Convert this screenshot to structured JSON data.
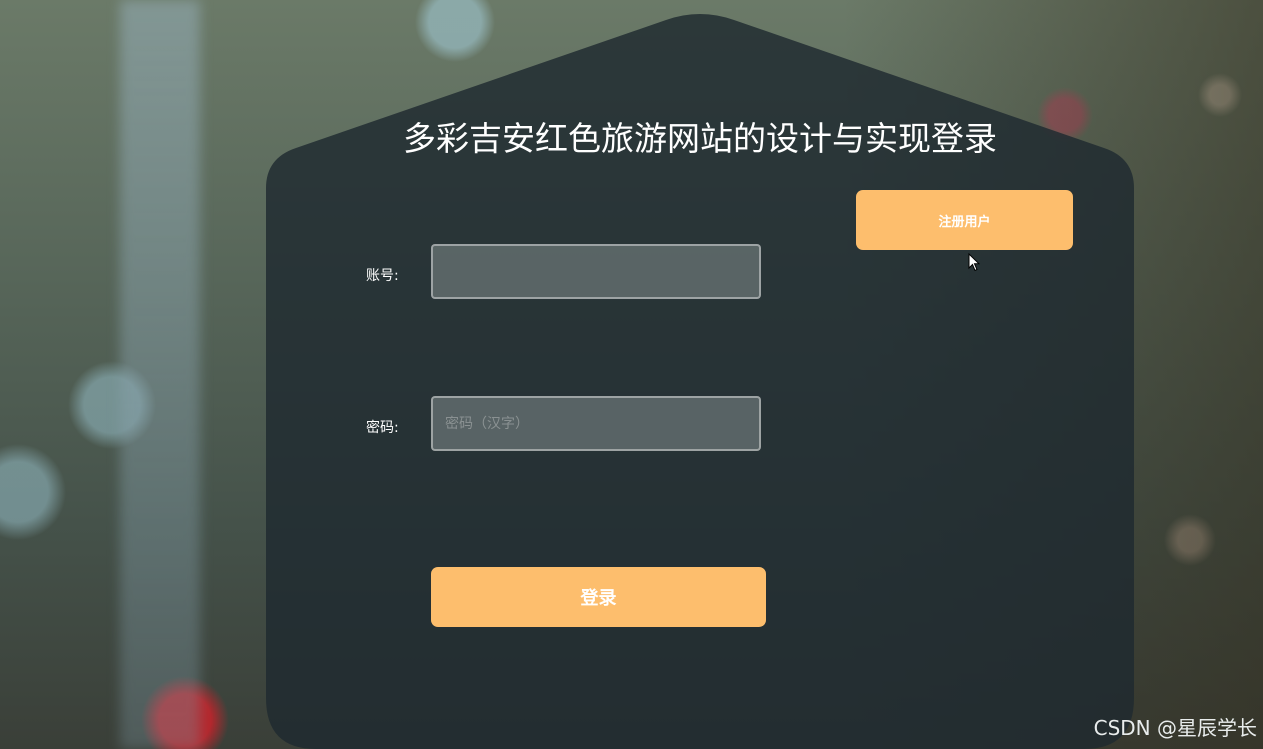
{
  "page": {
    "title": "多彩吉安红色旅游网站的设计与实现登录"
  },
  "form": {
    "account_label": "账号:",
    "account_value": "",
    "account_placeholder": "",
    "password_label": "密码:",
    "password_value": "",
    "password_placeholder": "密码（汉字）",
    "login_label": "登录"
  },
  "register_button_label": "注册用户",
  "watermark": "CSDN @星辰学长",
  "colors": {
    "accent": "#fdbe6d",
    "panel": "#1e2a30",
    "text": "#ffffff"
  },
  "icons": {
    "cursor": "mouse-pointer-icon"
  }
}
